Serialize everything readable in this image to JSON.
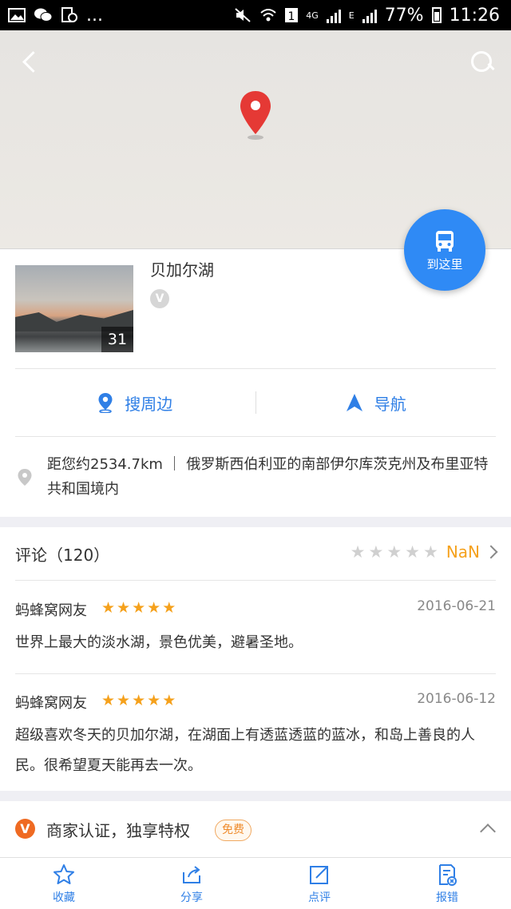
{
  "status_bar": {
    "left_text": "...",
    "network_1": "4G",
    "network_2": "E",
    "battery": "77%",
    "time": "11:26"
  },
  "map": {
    "go_button_label": "到这里"
  },
  "place": {
    "title": "贝加尔湖",
    "photo_count": "31",
    "verified_badge": "V",
    "actions": [
      {
        "label": "搜周边",
        "icon": "location-pin-icon"
      },
      {
        "label": "导航",
        "icon": "navigation-arrow-icon"
      }
    ],
    "address_text": "距您约2534.7km ｜ 俄罗斯西伯利亚的南部伊尔库茨克州及布里亚特共和国境内"
  },
  "reviews": {
    "title": "评论（120）",
    "score": "NaN",
    "items": [
      {
        "user": "蚂蜂窝网友",
        "date": "2016-06-21",
        "text": "世界上最大的淡水湖，景色优美，避暑圣地。"
      },
      {
        "user": "蚂蜂窝网友",
        "date": "2016-06-12",
        "text": "超级喜欢冬天的贝加尔湖，在湖面上有透蓝透蓝的蓝冰，和岛上善良的人民。很希望夏天能再去一次。"
      }
    ]
  },
  "merchant": {
    "icon_letter": "V",
    "text": "商家认证，独享特权",
    "badge": "免费"
  },
  "bottom_bar": [
    {
      "label": "收藏",
      "icon": "star-icon"
    },
    {
      "label": "分享",
      "icon": "share-icon"
    },
    {
      "label": "点评",
      "icon": "edit-icon"
    },
    {
      "label": "报错",
      "icon": "report-icon"
    }
  ],
  "colors": {
    "accent_blue": "#2f8af5",
    "star_orange": "#f5a11c",
    "merchant_orange": "#ef6a22",
    "pin_red": "#e53935"
  }
}
